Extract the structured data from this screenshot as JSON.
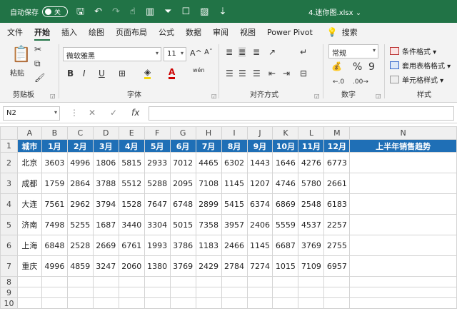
{
  "titlebar": {
    "autosave_label": "自动保存",
    "toggle_label": "关",
    "filename": "4.迷你图.xlsx",
    "filename_dropdown": "⌄"
  },
  "tabs": [
    "文件",
    "开始",
    "插入",
    "绘图",
    "页面布局",
    "公式",
    "数据",
    "审阅",
    "视图",
    "Power Pivot"
  ],
  "active_tab": "开始",
  "search_label": "搜索",
  "ribbon": {
    "clipboard": {
      "paste_label": "粘贴",
      "group_label": "剪贴板"
    },
    "font": {
      "font_name": "微软雅黑",
      "font_size": "11",
      "bold": "B",
      "italic": "I",
      "underline": "U",
      "grow": "A^",
      "shrink": "Aˇ",
      "wen": "wén",
      "group_label": "字体"
    },
    "align": {
      "group_label": "对齐方式"
    },
    "number": {
      "format": "常规",
      "percent": "%",
      "comma": "9",
      "group_label": "数字"
    },
    "styles": {
      "conditional": "条件格式 ▾",
      "table_format": "套用表格格式 ▾",
      "cell_styles": "单元格样式 ▾",
      "group_label": "样式"
    }
  },
  "formula_bar": {
    "name_box": "N2",
    "fx": "fx",
    "cancel": "✕",
    "enter": "✓",
    "dots": "⋮"
  },
  "grid": {
    "col_headers": [
      "A",
      "B",
      "C",
      "D",
      "E",
      "F",
      "G",
      "H",
      "I",
      "J",
      "K",
      "L",
      "M",
      "N"
    ],
    "header_row": [
      "城市",
      "1月",
      "2月",
      "3月",
      "4月",
      "5月",
      "6月",
      "7月",
      "8月",
      "9月",
      "10月",
      "11月",
      "12月",
      "上半年销售趋势"
    ],
    "rows": [
      [
        "北京",
        "3603",
        "4996",
        "1806",
        "5815",
        "2933",
        "7012",
        "4465",
        "6302",
        "1443",
        "1646",
        "4276",
        "6773",
        ""
      ],
      [
        "成都",
        "1759",
        "2864",
        "3788",
        "5512",
        "5288",
        "2095",
        "7108",
        "1145",
        "1207",
        "4746",
        "5780",
        "2661",
        ""
      ],
      [
        "大连",
        "7561",
        "2962",
        "3794",
        "1528",
        "7647",
        "6748",
        "2899",
        "5415",
        "6374",
        "6869",
        "2548",
        "6183",
        ""
      ],
      [
        "济南",
        "7498",
        "5255",
        "1687",
        "3440",
        "3304",
        "5015",
        "7358",
        "3957",
        "2406",
        "5559",
        "4537",
        "2257",
        ""
      ],
      [
        "上海",
        "6848",
        "2528",
        "2669",
        "6761",
        "1993",
        "3786",
        "1183",
        "2466",
        "1145",
        "6687",
        "3769",
        "2755",
        ""
      ],
      [
        "重庆",
        "4996",
        "4859",
        "3247",
        "2060",
        "1380",
        "3769",
        "2429",
        "2784",
        "7274",
        "1015",
        "7109",
        "6957",
        ""
      ]
    ],
    "row_numbers": [
      "1",
      "2",
      "3",
      "4",
      "5",
      "6",
      "7",
      "8",
      "9",
      "10"
    ]
  },
  "colors": {
    "title_green": "#217346",
    "header_blue": "#1f6fb6"
  }
}
